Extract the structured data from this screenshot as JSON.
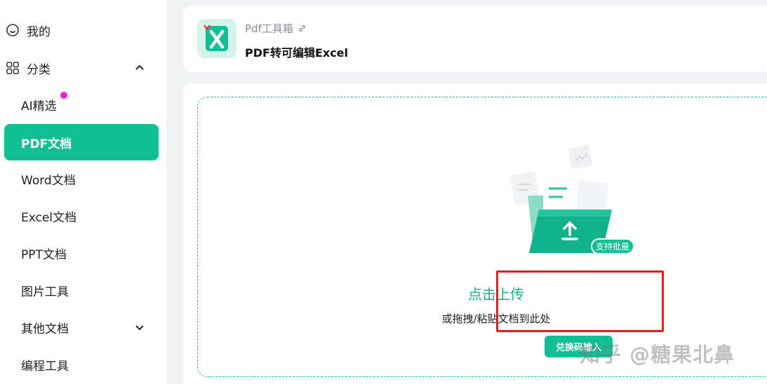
{
  "sidebar": {
    "mine_label": "我的",
    "category_label": "分类",
    "items": [
      {
        "label": "AI精选"
      },
      {
        "label": "PDF文档"
      },
      {
        "label": "Word文档"
      },
      {
        "label": "Excel文档"
      },
      {
        "label": "PPT文档"
      },
      {
        "label": "图片工具"
      },
      {
        "label": "其他文档"
      },
      {
        "label": "编程工具"
      }
    ]
  },
  "header": {
    "breadcrumb": "Pdf工具箱",
    "title": "PDF转可编辑Excel"
  },
  "upload": {
    "batch_badge": "支持批量",
    "title": "点击上传",
    "subtitle": "或拖拽/粘贴文档到此处",
    "redeem_button": "兑换码输入"
  },
  "watermark": "知乎 @糖果北鼻",
  "colors": {
    "accent": "#11bf95",
    "highlight": "#e02020",
    "notification_dot": "#e81fd2"
  }
}
